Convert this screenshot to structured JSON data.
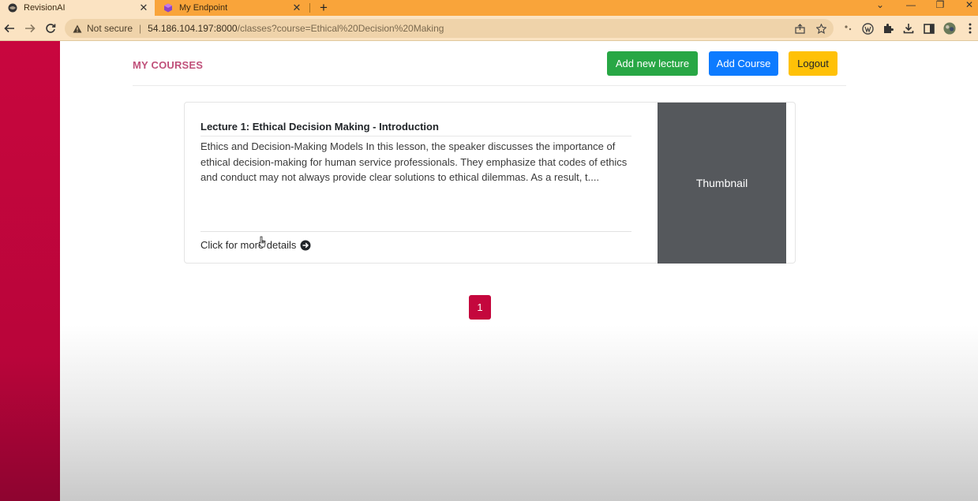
{
  "browser": {
    "tabs": [
      {
        "title": "RevisionAI",
        "favicon": "globe-icon"
      },
      {
        "title": "My Endpoint",
        "favicon": "cube-icon"
      }
    ],
    "new_tab_label": "+",
    "address": {
      "security_label": "Not secure",
      "divider": "|",
      "host": "54.186.104.197:8000",
      "path": "/classes?course=Ethical%20Decision%20Making"
    }
  },
  "header": {
    "title": "MY COURSES",
    "add_lecture_label": "Add new lecture",
    "add_course_label": "Add Course",
    "logout_label": "Logout"
  },
  "lectures": [
    {
      "title": "Lecture 1: Ethical Decision Making - Introduction",
      "summary": "Ethics and Decision-Making Models In this lesson, the speaker discusses the importance of ethical decision-making for human service professionals. They emphasize that codes of ethics and conduct may not always provide clear solutions to ethical dilemmas. As a result, t....",
      "details_label": "Click for more details",
      "thumbnail_label": "Thumbnail"
    }
  ],
  "pagination": {
    "current_page": "1"
  },
  "colors": {
    "sidebar": "#c8063e",
    "title": "#c0507a",
    "add_lecture": "#28a745",
    "add_course": "#0d7bff",
    "logout": "#ffc107",
    "pager": "#c4073d",
    "thumbnail": "#55585c"
  }
}
